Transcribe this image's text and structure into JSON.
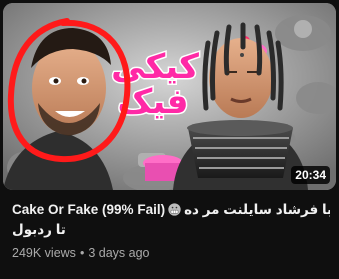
{
  "video": {
    "duration": "20:34",
    "title_part_1": "Cake Or Fake (99% Fail)",
    "title_part_2": "با فرشاد سایلنت مر ده",
    "title_part_3": "تا ردبول",
    "views": "249K views",
    "separator": "•",
    "age": "3 days ago"
  },
  "thumbnail": {
    "overlay_text_line_1": "کیکی",
    "overlay_text_line_2": "فیک"
  },
  "colors": {
    "background": "#0f0f0f",
    "title": "#f1f1f1",
    "meta": "#aaaaaa",
    "circle_annotation": "#ff1a1a"
  }
}
